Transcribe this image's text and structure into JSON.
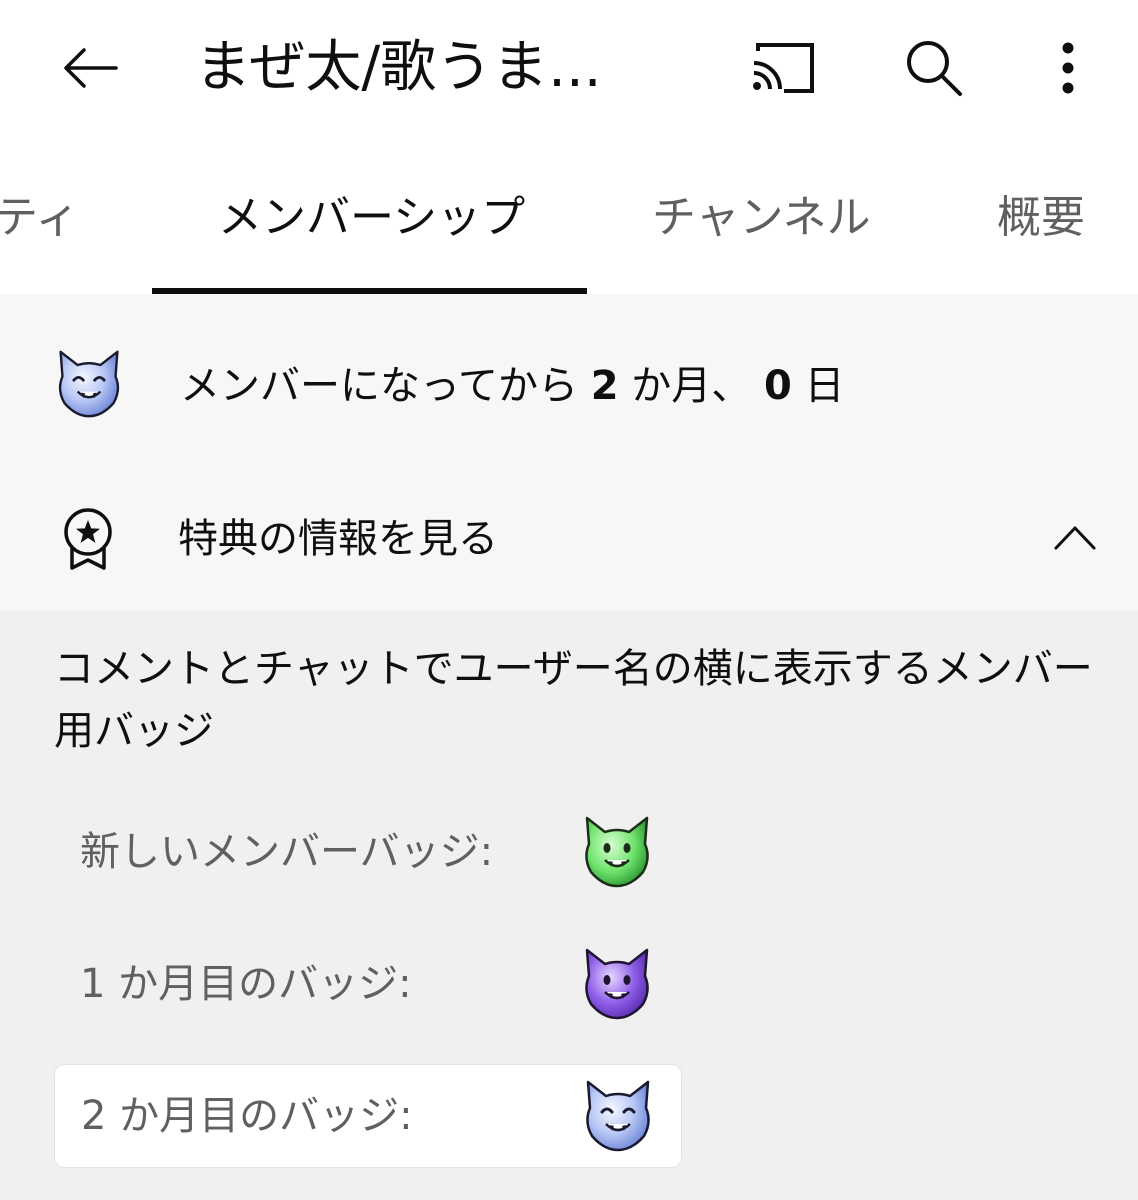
{
  "appbar": {
    "title": "まぜ太/歌うま...",
    "icons": {
      "back": "arrow-left-icon",
      "cast": "cast-icon",
      "search": "search-icon",
      "more": "more-vertical-icon"
    }
  },
  "tabs": [
    {
      "label": "ティ"
    },
    {
      "label": "メンバーシップ",
      "active": true
    },
    {
      "label": "チャンネル"
    },
    {
      "label": "概要"
    }
  ],
  "membership": {
    "duration_prefix": "メンバーになってから ",
    "months": "2",
    "months_unit": " か月、 ",
    "days": "0",
    "days_unit": " 日",
    "perks_label": "特典の情報を見る"
  },
  "perks": {
    "description": "コメントとチャットでユーザー名の横に表示するメンバー用バッジ",
    "badges": [
      {
        "label": "新しいメンバーバッジ:",
        "color": "green"
      },
      {
        "label": "1 か月目のバッジ:",
        "color": "purple"
      },
      {
        "label": "2 か月目のバッジ:",
        "color": "blue"
      }
    ]
  },
  "colors": {
    "text_primary": "#0f0f0f",
    "text_secondary": "#606060",
    "badge_green": "#6ee36b",
    "badge_purple": "#8e5de8",
    "badge_blue": "#9fb6f2"
  }
}
